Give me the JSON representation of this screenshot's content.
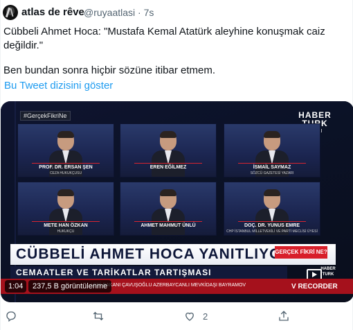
{
  "tweet": {
    "display_name": "atlas de rêve",
    "handle_line": "@ruyaatlasi · 7s",
    "text_line1": "Cübbeli Ahmet Hoca: \"Mustafa Kemal Atatürk aleyhine konuşmak caiz değildir.\"",
    "text_line2": "Ben bundan sonra hiçbir sözüne itibar etmem.",
    "thread_link": "Bu Tweet dizisini göster"
  },
  "video": {
    "hashtag": "#GerçekFikriNe",
    "channel_logo_line1": "HABER",
    "channel_logo_line2": "TURK",
    "channel_logo_line3": "CANLI",
    "panels": [
      {
        "name": "PROF. DR. ERSAN ŞEN",
        "title": "CEZA HUKUKÇUSU"
      },
      {
        "name": "EREN EĞİLMEZ",
        "title": ""
      },
      {
        "name": "İSMAİL SAYMAZ",
        "title": "SÖZCÜ GAZETESİ YAZARI"
      },
      {
        "name": "METE HAN ÖZKAN",
        "title": "HUKUKÇU"
      },
      {
        "name": "AHMET MAHMUT ÜNLÜ",
        "title": ""
      },
      {
        "name": "DOÇ. DR. YUNUS EMRE",
        "title": "CHP İSTANBUL MİLLETVEKİLİ VE PARTİ MECLİSİ ÜYESİ"
      }
    ],
    "headline": "CÜBBELİ AHMET HOCA YANITLIYOR",
    "badge": "GERÇEK FİKRİ NE?",
    "subheadline": "CEMAATLER VE TARİKATLAR TARTIŞMASI",
    "ticker": "LERİ BAKANI ÇAVUŞOĞLU AZERBAYCANLI MEVKİDAŞI BAYRAMOV",
    "time": "1:04",
    "views": "237,5 B görüntülenme",
    "watermark": "V RECORDER"
  },
  "actions": {
    "reply_count": "",
    "retweet_count": "",
    "like_count": "2",
    "share_count": ""
  },
  "colors": {
    "link": "#1d9bf0",
    "secondary_text": "#536471",
    "news_red": "#d81f2a"
  }
}
